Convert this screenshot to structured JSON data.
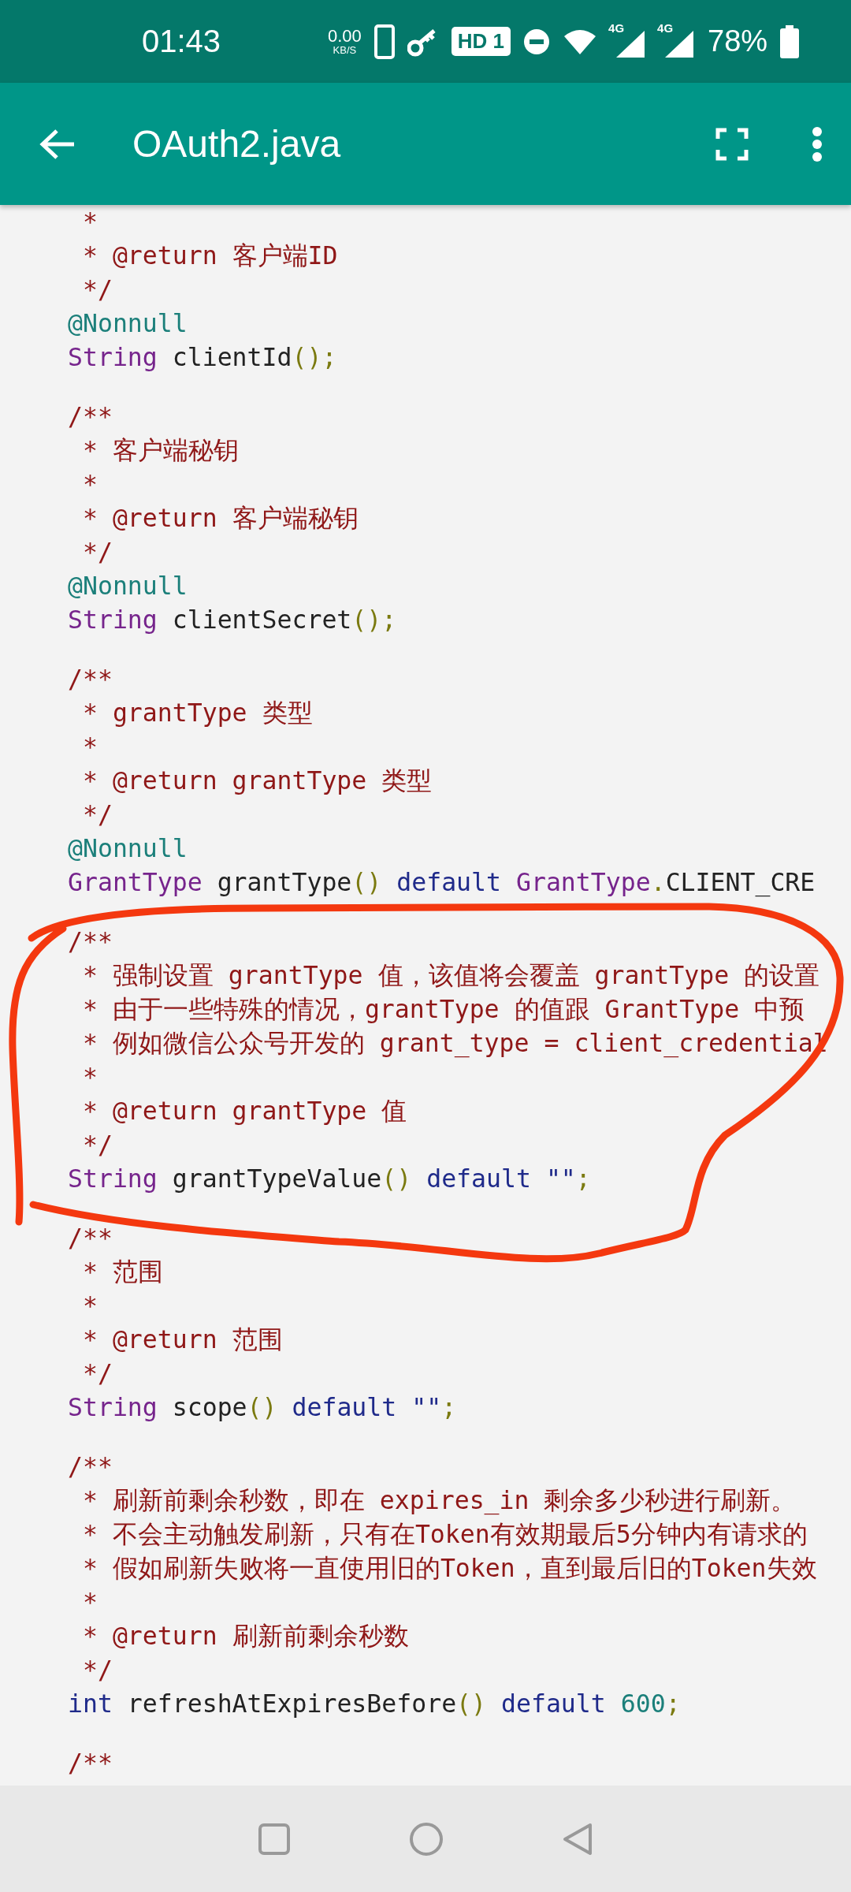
{
  "status_bar": {
    "time": "01:43",
    "net_speed": "0.00",
    "net_unit": "KB/S",
    "hd_badge": "HD 1",
    "signals": [
      "4G",
      "4G"
    ],
    "battery": "78%"
  },
  "app_bar": {
    "title": "OAuth2.java"
  },
  "code": {
    "lines": [
      {
        "kind": "code",
        "tokens": [
          {
            "kind": "comment",
            "text": " *"
          }
        ]
      },
      {
        "kind": "code",
        "tokens": [
          {
            "kind": "comment",
            "text": " * @return 客户端ID"
          }
        ]
      },
      {
        "kind": "code",
        "tokens": [
          {
            "kind": "comment",
            "text": " */"
          }
        ]
      },
      {
        "kind": "code",
        "tokens": [
          {
            "kind": "annotation",
            "text": "@Nonnull"
          }
        ]
      },
      {
        "kind": "code",
        "tokens": [
          {
            "kind": "type",
            "text": "String"
          },
          {
            "kind": "plain",
            "text": " clientId"
          },
          {
            "kind": "punct",
            "text": "();"
          }
        ]
      },
      {
        "kind": "blank"
      },
      {
        "kind": "code",
        "tokens": [
          {
            "kind": "comment",
            "text": "/**"
          }
        ]
      },
      {
        "kind": "code",
        "tokens": [
          {
            "kind": "comment",
            "text": " * 客户端秘钥"
          }
        ]
      },
      {
        "kind": "code",
        "tokens": [
          {
            "kind": "comment",
            "text": " *"
          }
        ]
      },
      {
        "kind": "code",
        "tokens": [
          {
            "kind": "comment",
            "text": " * @return 客户端秘钥"
          }
        ]
      },
      {
        "kind": "code",
        "tokens": [
          {
            "kind": "comment",
            "text": " */"
          }
        ]
      },
      {
        "kind": "code",
        "tokens": [
          {
            "kind": "annotation",
            "text": "@Nonnull"
          }
        ]
      },
      {
        "kind": "code",
        "tokens": [
          {
            "kind": "type",
            "text": "String"
          },
          {
            "kind": "plain",
            "text": " clientSecret"
          },
          {
            "kind": "punct",
            "text": "();"
          }
        ]
      },
      {
        "kind": "blank"
      },
      {
        "kind": "code",
        "tokens": [
          {
            "kind": "comment",
            "text": "/**"
          }
        ]
      },
      {
        "kind": "code",
        "tokens": [
          {
            "kind": "comment",
            "text": " * grantType 类型"
          }
        ]
      },
      {
        "kind": "code",
        "tokens": [
          {
            "kind": "comment",
            "text": " *"
          }
        ]
      },
      {
        "kind": "code",
        "tokens": [
          {
            "kind": "comment",
            "text": " * @return grantType 类型"
          }
        ]
      },
      {
        "kind": "code",
        "tokens": [
          {
            "kind": "comment",
            "text": " */"
          }
        ]
      },
      {
        "kind": "code",
        "tokens": [
          {
            "kind": "annotation",
            "text": "@Nonnull"
          }
        ]
      },
      {
        "kind": "code",
        "tokens": [
          {
            "kind": "type",
            "text": "GrantType"
          },
          {
            "kind": "plain",
            "text": " grantType"
          },
          {
            "kind": "punct",
            "text": "()"
          },
          {
            "kind": "keyword",
            "text": " default "
          },
          {
            "kind": "type",
            "text": "GrantType"
          },
          {
            "kind": "punct",
            "text": "."
          },
          {
            "kind": "plain",
            "text": "CLIENT_CRE"
          }
        ]
      },
      {
        "kind": "blank"
      },
      {
        "kind": "code",
        "tokens": [
          {
            "kind": "comment",
            "text": "/**"
          }
        ]
      },
      {
        "kind": "code",
        "tokens": [
          {
            "kind": "comment",
            "text": " * 强制设置 grantType 值，该值将会覆盖 grantType 的设置"
          }
        ]
      },
      {
        "kind": "code",
        "tokens": [
          {
            "kind": "comment",
            "text": " * 由于一些特殊的情况，grantType 的值跟 GrantType 中预"
          }
        ]
      },
      {
        "kind": "code",
        "tokens": [
          {
            "kind": "comment",
            "text": " * 例如微信公众号开发的 grant_type = client_credential"
          }
        ]
      },
      {
        "kind": "code",
        "tokens": [
          {
            "kind": "comment",
            "text": " *"
          }
        ]
      },
      {
        "kind": "code",
        "tokens": [
          {
            "kind": "comment",
            "text": " * @return grantType 值"
          }
        ]
      },
      {
        "kind": "code",
        "tokens": [
          {
            "kind": "comment",
            "text": " */"
          }
        ]
      },
      {
        "kind": "code",
        "tokens": [
          {
            "kind": "type",
            "text": "String"
          },
          {
            "kind": "plain",
            "text": " grantTypeValue"
          },
          {
            "kind": "punct",
            "text": "()"
          },
          {
            "kind": "keyword",
            "text": " default "
          },
          {
            "kind": "string",
            "text": "\"\""
          },
          {
            "kind": "punct",
            "text": ";"
          }
        ]
      },
      {
        "kind": "blank"
      },
      {
        "kind": "code",
        "tokens": [
          {
            "kind": "comment",
            "text": "/**"
          }
        ]
      },
      {
        "kind": "code",
        "tokens": [
          {
            "kind": "comment",
            "text": " * 范围"
          }
        ]
      },
      {
        "kind": "code",
        "tokens": [
          {
            "kind": "comment",
            "text": " *"
          }
        ]
      },
      {
        "kind": "code",
        "tokens": [
          {
            "kind": "comment",
            "text": " * @return 范围"
          }
        ]
      },
      {
        "kind": "code",
        "tokens": [
          {
            "kind": "comment",
            "text": " */"
          }
        ]
      },
      {
        "kind": "code",
        "tokens": [
          {
            "kind": "type",
            "text": "String"
          },
          {
            "kind": "plain",
            "text": " scope"
          },
          {
            "kind": "punct",
            "text": "()"
          },
          {
            "kind": "keyword",
            "text": " default "
          },
          {
            "kind": "string",
            "text": "\"\""
          },
          {
            "kind": "punct",
            "text": ";"
          }
        ]
      },
      {
        "kind": "blank"
      },
      {
        "kind": "code",
        "tokens": [
          {
            "kind": "comment",
            "text": "/**"
          }
        ]
      },
      {
        "kind": "code",
        "tokens": [
          {
            "kind": "comment",
            "text": " * 刷新前剩余秒数，即在 expires_in 剩余多少秒进行刷新。"
          }
        ]
      },
      {
        "kind": "code",
        "tokens": [
          {
            "kind": "comment",
            "text": " * 不会主动触发刷新，只有在Token有效期最后5分钟内有请求的"
          }
        ]
      },
      {
        "kind": "code",
        "tokens": [
          {
            "kind": "comment",
            "text": " * 假如刷新失败将一直使用旧的Token，直到最后旧的Token失效"
          }
        ]
      },
      {
        "kind": "code",
        "tokens": [
          {
            "kind": "comment",
            "text": " *"
          }
        ]
      },
      {
        "kind": "code",
        "tokens": [
          {
            "kind": "comment",
            "text": " * @return 刷新前剩余秒数"
          }
        ]
      },
      {
        "kind": "code",
        "tokens": [
          {
            "kind": "comment",
            "text": " */"
          }
        ]
      },
      {
        "kind": "code",
        "tokens": [
          {
            "kind": "keyword",
            "text": "int"
          },
          {
            "kind": "plain",
            "text": " refreshAtExpiresBefore"
          },
          {
            "kind": "punct",
            "text": "()"
          },
          {
            "kind": "keyword",
            "text": " default "
          },
          {
            "kind": "number",
            "text": "600"
          },
          {
            "kind": "punct",
            "text": ";"
          }
        ]
      },
      {
        "kind": "blank"
      },
      {
        "kind": "code",
        "tokens": [
          {
            "kind": "comment",
            "text": "/**"
          }
        ]
      }
    ]
  }
}
